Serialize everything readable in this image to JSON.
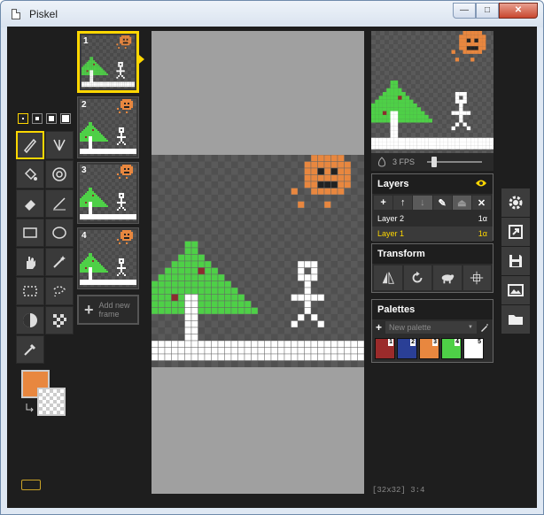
{
  "window": {
    "title": "Piskel",
    "min_label": "—",
    "max_label": "□",
    "close_label": "✕"
  },
  "tools": {
    "pen_sizes": [
      1,
      2,
      3,
      4
    ],
    "items": [
      "pen-icon",
      "vertical-mirror-pen-icon",
      "paint-bucket-icon",
      "paint-all-similar-icon",
      "eraser-icon",
      "stroke-icon",
      "rectangle-icon",
      "circle-icon",
      "move-icon",
      "shape-selection-icon",
      "rectangle-selection-icon",
      "lasso-selection-icon",
      "lighten-icon",
      "dithering-icon",
      "color-picker-icon"
    ],
    "primary_color": "#e8873f",
    "secondary_color": "transparent"
  },
  "frames": {
    "items": [
      {
        "num": "1"
      },
      {
        "num": "2"
      },
      {
        "num": "3"
      },
      {
        "num": "4"
      }
    ],
    "add_label": "Add new frame"
  },
  "status": {
    "size": "[32x32]",
    "coords": "3:4"
  },
  "fps": {
    "label": "3 FPS",
    "value": 3
  },
  "layers": {
    "title": "Layers",
    "toolbar": [
      "+",
      "↑",
      "↓",
      "✎",
      "⏏",
      "✕"
    ],
    "items": [
      {
        "name": "Layer 2",
        "alpha": "1α",
        "active": false
      },
      {
        "name": "Layer 1",
        "alpha": "1α",
        "active": true
      }
    ]
  },
  "transform": {
    "title": "Transform"
  },
  "palettes": {
    "title": "Palettes",
    "add": "+",
    "selected": "New palette",
    "swatches": [
      {
        "num": "1",
        "color": "#9b2b2b"
      },
      {
        "num": "2",
        "color": "#2a3f96"
      },
      {
        "num": "3",
        "color": "#e8873f"
      },
      {
        "num": "4",
        "color": "#4ed047"
      },
      {
        "num": "5",
        "color": "#ffffff"
      }
    ]
  },
  "colors": {
    "tree": "#4ed047",
    "trunk": "#ffffff",
    "ornament": "#8b2d2d",
    "pumpkin": "#e8873f",
    "pumpkin_face": "#222222",
    "ground": "#ffffff",
    "accent": "#ffd700"
  }
}
